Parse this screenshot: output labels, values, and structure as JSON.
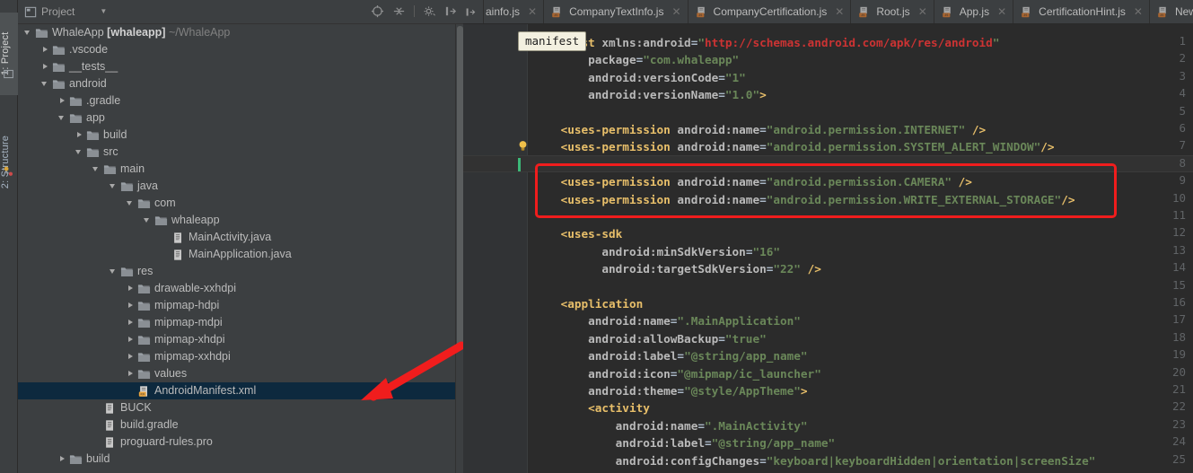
{
  "window": {
    "tool_tabs": [
      {
        "label": "1: Project",
        "selected": true,
        "icon": "project-icon"
      },
      {
        "label": "2: Structure",
        "selected": false,
        "icon": "structure-icon"
      }
    ]
  },
  "project_panel": {
    "title": "Project",
    "dropdown_icon": "chevron-down-icon",
    "toolbar_icons": [
      "target-locate-icon",
      "collapse-all-icon",
      "settings-gear-icon",
      "hide-panel-icon"
    ],
    "tree": [
      {
        "depth": 0,
        "arrow": "open",
        "icon": "folder",
        "label": "WhaleApp",
        "bold": "[whaleapp]",
        "dim": "~/WhaleApp",
        "selected": false
      },
      {
        "depth": 1,
        "arrow": "closed",
        "icon": "folder",
        "label": ".vscode",
        "selected": false
      },
      {
        "depth": 1,
        "arrow": "closed",
        "icon": "folder",
        "label": "__tests__",
        "selected": false
      },
      {
        "depth": 1,
        "arrow": "open",
        "icon": "folder",
        "label": "android",
        "selected": false
      },
      {
        "depth": 2,
        "arrow": "closed",
        "icon": "folder",
        "label": ".gradle",
        "selected": false
      },
      {
        "depth": 2,
        "arrow": "open",
        "icon": "folder",
        "label": "app",
        "selected": false
      },
      {
        "depth": 3,
        "arrow": "closed",
        "icon": "folder",
        "label": "build",
        "selected": false
      },
      {
        "depth": 3,
        "arrow": "open",
        "icon": "folder",
        "label": "src",
        "selected": false
      },
      {
        "depth": 4,
        "arrow": "open",
        "icon": "folder",
        "label": "main",
        "selected": false
      },
      {
        "depth": 5,
        "arrow": "open",
        "icon": "folder",
        "label": "java",
        "selected": false
      },
      {
        "depth": 6,
        "arrow": "open",
        "icon": "folder",
        "label": "com",
        "selected": false
      },
      {
        "depth": 7,
        "arrow": "open",
        "icon": "folder",
        "label": "whaleapp",
        "selected": false
      },
      {
        "depth": 8,
        "arrow": "none",
        "icon": "java-file",
        "label": "MainActivity.java",
        "selected": false
      },
      {
        "depth": 8,
        "arrow": "none",
        "icon": "java-file",
        "label": "MainApplication.java",
        "selected": false
      },
      {
        "depth": 5,
        "arrow": "open",
        "icon": "folder",
        "label": "res",
        "selected": false
      },
      {
        "depth": 6,
        "arrow": "closed",
        "icon": "folder",
        "label": "drawable-xxhdpi",
        "selected": false
      },
      {
        "depth": 6,
        "arrow": "closed",
        "icon": "folder",
        "label": "mipmap-hdpi",
        "selected": false
      },
      {
        "depth": 6,
        "arrow": "closed",
        "icon": "folder",
        "label": "mipmap-mdpi",
        "selected": false
      },
      {
        "depth": 6,
        "arrow": "closed",
        "icon": "folder",
        "label": "mipmap-xhdpi",
        "selected": false
      },
      {
        "depth": 6,
        "arrow": "closed",
        "icon": "folder",
        "label": "mipmap-xxhdpi",
        "selected": false
      },
      {
        "depth": 6,
        "arrow": "closed",
        "icon": "folder",
        "label": "values",
        "selected": false
      },
      {
        "depth": 6,
        "arrow": "none",
        "icon": "android-xml-file",
        "label": "AndroidManifest.xml",
        "selected": true
      },
      {
        "depth": 4,
        "arrow": "none",
        "icon": "file",
        "label": "BUCK",
        "selected": false
      },
      {
        "depth": 4,
        "arrow": "none",
        "icon": "file",
        "label": "build.gradle",
        "selected": false
      },
      {
        "depth": 4,
        "arrow": "none",
        "icon": "file",
        "label": "proguard-rules.pro",
        "selected": false
      },
      {
        "depth": 2,
        "arrow": "closed",
        "icon": "folder",
        "label": "build",
        "selected": false
      }
    ]
  },
  "editor": {
    "tabs": [
      {
        "label": "ainfo.js",
        "partial": true,
        "icon": "js-file-icon",
        "closable": true
      },
      {
        "label": "CompanyTextInfo.js",
        "partial": false,
        "icon": "js-file-icon",
        "closable": true
      },
      {
        "label": "CompanyCertification.js",
        "partial": false,
        "icon": "js-file-icon",
        "closable": true
      },
      {
        "label": "Root.js",
        "partial": false,
        "icon": "js-file-icon",
        "closable": true
      },
      {
        "label": "App.js",
        "partial": false,
        "icon": "js-file-icon",
        "closable": true
      },
      {
        "label": "CertificationHint.js",
        "partial": false,
        "icon": "js-file-icon",
        "closable": true
      },
      {
        "label": "News.js",
        "partial": false,
        "icon": "js-file-icon",
        "closable": true
      }
    ],
    "breadcrumb": "manifest",
    "current_line": 8,
    "bulb_line": 7,
    "highlight_box_lines": [
      9,
      10
    ],
    "colors": {
      "background": "#2b2b2b",
      "gutter": "#313335",
      "tag": "#e8bf6a",
      "string": "#6a8759",
      "url_string": "#cc3333",
      "attribute": "#bababa",
      "line_number": "#606366",
      "selection": "#0d293e",
      "annotation_red": "#f01d1d",
      "caret_green": "#3cb878"
    },
    "lines": [
      {
        "n": 1,
        "indent": 0,
        "tokens": [
          [
            "tag",
            "<manifest"
          ],
          [
            "plain",
            " "
          ],
          [
            "ns",
            "xmlns:android"
          ],
          [
            "eq",
            "="
          ],
          [
            "str",
            "\""
          ],
          [
            "url",
            "http://schemas.android.com/apk/res/android"
          ],
          [
            "str",
            "\""
          ]
        ]
      },
      {
        "n": 2,
        "indent": 4,
        "tokens": [
          [
            "attr",
            "package"
          ],
          [
            "eq",
            "="
          ],
          [
            "str",
            "\"com.whaleapp\""
          ]
        ]
      },
      {
        "n": 3,
        "indent": 4,
        "tokens": [
          [
            "attr",
            "android:versionCode"
          ],
          [
            "eq",
            "="
          ],
          [
            "str",
            "\"1\""
          ]
        ]
      },
      {
        "n": 4,
        "indent": 4,
        "tokens": [
          [
            "attr",
            "android:versionName"
          ],
          [
            "eq",
            "="
          ],
          [
            "str",
            "\"1.0\""
          ],
          [
            "tag",
            ">"
          ]
        ]
      },
      {
        "n": 5,
        "indent": 0,
        "tokens": []
      },
      {
        "n": 6,
        "indent": 2,
        "tokens": [
          [
            "tag",
            "<uses-permission"
          ],
          [
            "plain",
            " "
          ],
          [
            "attr",
            "android:name"
          ],
          [
            "eq",
            "="
          ],
          [
            "str",
            "\"android.permission.INTERNET\""
          ],
          [
            "plain",
            " "
          ],
          [
            "tag",
            "/>"
          ]
        ]
      },
      {
        "n": 7,
        "indent": 2,
        "tokens": [
          [
            "tag",
            "<uses-permission"
          ],
          [
            "plain",
            " "
          ],
          [
            "attr",
            "android:name"
          ],
          [
            "eq",
            "="
          ],
          [
            "str",
            "\"android.permission.SYSTEM_ALERT_WINDOW\""
          ],
          [
            "tag",
            "/>"
          ]
        ]
      },
      {
        "n": 8,
        "indent": 0,
        "tokens": []
      },
      {
        "n": 9,
        "indent": 2,
        "tokens": [
          [
            "tag",
            "<uses-permission"
          ],
          [
            "plain",
            " "
          ],
          [
            "attr",
            "android:name"
          ],
          [
            "eq",
            "="
          ],
          [
            "str",
            "\"android.permission.CAMERA\""
          ],
          [
            "plain",
            " "
          ],
          [
            "tag",
            "/>"
          ]
        ]
      },
      {
        "n": 10,
        "indent": 2,
        "tokens": [
          [
            "tag",
            "<uses-permission"
          ],
          [
            "plain",
            " "
          ],
          [
            "attr",
            "android:name"
          ],
          [
            "eq",
            "="
          ],
          [
            "str",
            "\"android.permission.WRITE_EXTERNAL_STORAGE\""
          ],
          [
            "tag",
            "/>"
          ]
        ]
      },
      {
        "n": 11,
        "indent": 0,
        "tokens": []
      },
      {
        "n": 12,
        "indent": 2,
        "tokens": [
          [
            "tag",
            "<uses-sdk"
          ]
        ]
      },
      {
        "n": 13,
        "indent": 5,
        "tokens": [
          [
            "attr",
            "android:minSdkVersion"
          ],
          [
            "eq",
            "="
          ],
          [
            "str",
            "\"16\""
          ]
        ]
      },
      {
        "n": 14,
        "indent": 5,
        "tokens": [
          [
            "attr",
            "android:targetSdkVersion"
          ],
          [
            "eq",
            "="
          ],
          [
            "str",
            "\"22\""
          ],
          [
            "plain",
            " "
          ],
          [
            "tag",
            "/>"
          ]
        ]
      },
      {
        "n": 15,
        "indent": 0,
        "tokens": []
      },
      {
        "n": 16,
        "indent": 2,
        "tokens": [
          [
            "tag",
            "<application"
          ]
        ]
      },
      {
        "n": 17,
        "indent": 4,
        "tokens": [
          [
            "attr",
            "android:name"
          ],
          [
            "eq",
            "="
          ],
          [
            "str",
            "\".MainApplication\""
          ]
        ]
      },
      {
        "n": 18,
        "indent": 4,
        "tokens": [
          [
            "attr",
            "android:allowBackup"
          ],
          [
            "eq",
            "="
          ],
          [
            "str",
            "\"true\""
          ]
        ]
      },
      {
        "n": 19,
        "indent": 4,
        "tokens": [
          [
            "attr",
            "android:label"
          ],
          [
            "eq",
            "="
          ],
          [
            "str",
            "\"@string/app_name\""
          ]
        ]
      },
      {
        "n": 20,
        "indent": 4,
        "tokens": [
          [
            "attr",
            "android:icon"
          ],
          [
            "eq",
            "="
          ],
          [
            "str",
            "\"@mipmap/ic_launcher\""
          ]
        ]
      },
      {
        "n": 21,
        "indent": 4,
        "tokens": [
          [
            "attr",
            "android:theme"
          ],
          [
            "eq",
            "="
          ],
          [
            "str",
            "\"@style/AppTheme\""
          ],
          [
            "tag",
            ">"
          ]
        ]
      },
      {
        "n": 22,
        "indent": 4,
        "tokens": [
          [
            "tag",
            "<activity"
          ]
        ]
      },
      {
        "n": 23,
        "indent": 6,
        "tokens": [
          [
            "attr",
            "android:name"
          ],
          [
            "eq",
            "="
          ],
          [
            "str",
            "\".MainActivity\""
          ]
        ]
      },
      {
        "n": 24,
        "indent": 6,
        "tokens": [
          [
            "attr",
            "android:label"
          ],
          [
            "eq",
            "="
          ],
          [
            "str",
            "\"@string/app_name\""
          ]
        ]
      },
      {
        "n": 25,
        "indent": 6,
        "tokens": [
          [
            "attr",
            "android:configChanges"
          ],
          [
            "eq",
            "="
          ],
          [
            "str",
            "\"keyboard|keyboardHidden|orientation|screenSize\""
          ]
        ]
      }
    ]
  },
  "annotations": {
    "arrow": {
      "name": "red-pointer-arrow",
      "points_to": "AndroidManifest.xml"
    },
    "box": {
      "name": "red-highlight-box",
      "wraps": "camera-and-storage-permission-lines"
    }
  }
}
